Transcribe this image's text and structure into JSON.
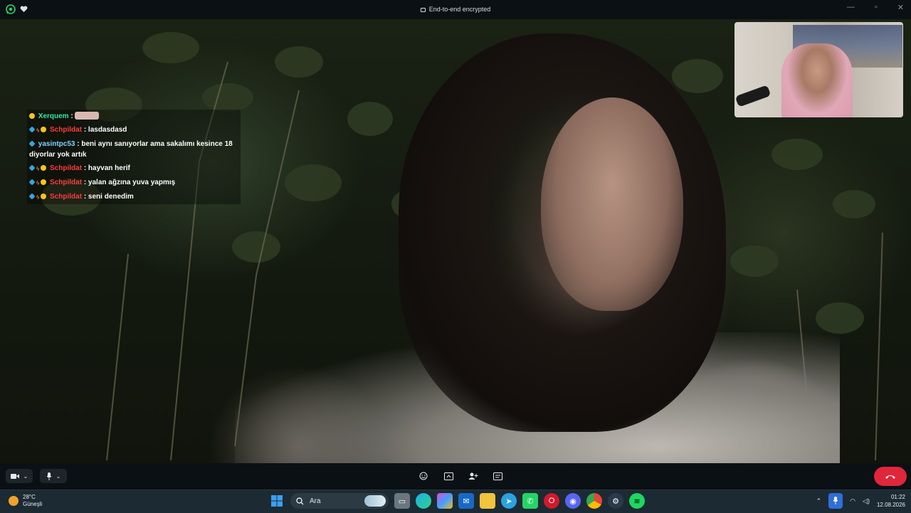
{
  "window": {
    "title": "End-to-end encrypted",
    "icons": [
      "whatsapp-icon",
      "heart-icon"
    ],
    "controls": [
      "minimize",
      "maximize",
      "close"
    ]
  },
  "chat": [
    {
      "user": "Xerquem",
      "badges": [
        "bits"
      ],
      "message": "",
      "user_color": "#2ee8a8",
      "redacted": true
    },
    {
      "user": "Schpildat",
      "badges": [
        "sub",
        "fire",
        "bits"
      ],
      "message": ": lasdasdasd",
      "user_color": "#ff3b3b"
    },
    {
      "user": "yasintpc53",
      "badges": [
        "sub"
      ],
      "message": ": beni aynı sanıyorlar ama sakalımı kesince 18 diyorlar yok artık",
      "user_color": "#7fd3ff"
    },
    {
      "user": "Schpildat",
      "badges": [
        "sub",
        "fire",
        "bits"
      ],
      "message": ": hayvan herif",
      "user_color": "#ff3b3b"
    },
    {
      "user": "Schpildat",
      "badges": [
        "sub",
        "fire",
        "bits"
      ],
      "message": ": yalan ağzına yuva yapmış",
      "user_color": "#ff3b3b"
    },
    {
      "user": "Schpildat",
      "badges": [
        "sub",
        "fire",
        "bits"
      ],
      "message": ": seni denedim",
      "user_color": "#ff3b3b"
    }
  ],
  "call_controls": {
    "left": [
      "camera-icon",
      "mic-icon"
    ],
    "center": [
      "emoji-icon",
      "screen-share-icon",
      "add-participant-icon",
      "captions-icon"
    ],
    "end_call": "phone-hangup-icon"
  },
  "taskbar": {
    "weather": {
      "temp": "28°C",
      "condition": "Güneşli"
    },
    "search_placeholder": "Ara",
    "apps": [
      "windows-start",
      "file-explorer",
      "edge",
      "copilot",
      "outlook",
      "files",
      "telegram",
      "whatsapp",
      "opera",
      "discord",
      "chrome",
      "steam",
      "spotify"
    ],
    "time": "01:22",
    "date": "12.08.2026"
  },
  "colors": {
    "accent_end_call": "#e0263a",
    "taskbar": "#1c2a33"
  }
}
